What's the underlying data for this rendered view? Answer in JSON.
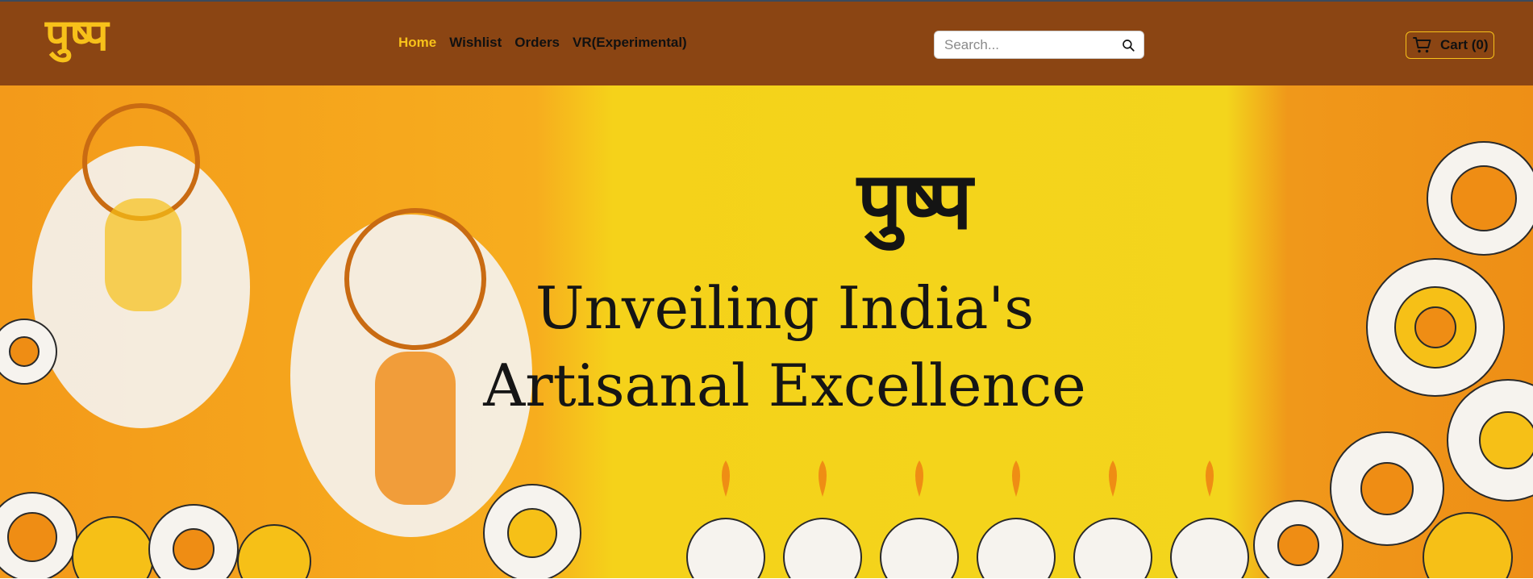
{
  "brand": {
    "logo_text": "पुष्प",
    "logo_color": "#f7c11a",
    "nav_bg": "#8b4513"
  },
  "nav": {
    "links": [
      {
        "label": "Home",
        "active": true
      },
      {
        "label": "Wishlist",
        "active": false
      },
      {
        "label": "Orders",
        "active": false
      },
      {
        "label": "VR(Experimental)",
        "active": false
      }
    ]
  },
  "search": {
    "placeholder": "Search...",
    "value": "",
    "icon": "search-icon"
  },
  "cart": {
    "label": "Cart (0)",
    "icon": "cart-icon"
  },
  "hero": {
    "title": "पुष्प",
    "tagline_line1": "Unveiling India's",
    "tagline_line2": "Artisanal Excellence"
  }
}
